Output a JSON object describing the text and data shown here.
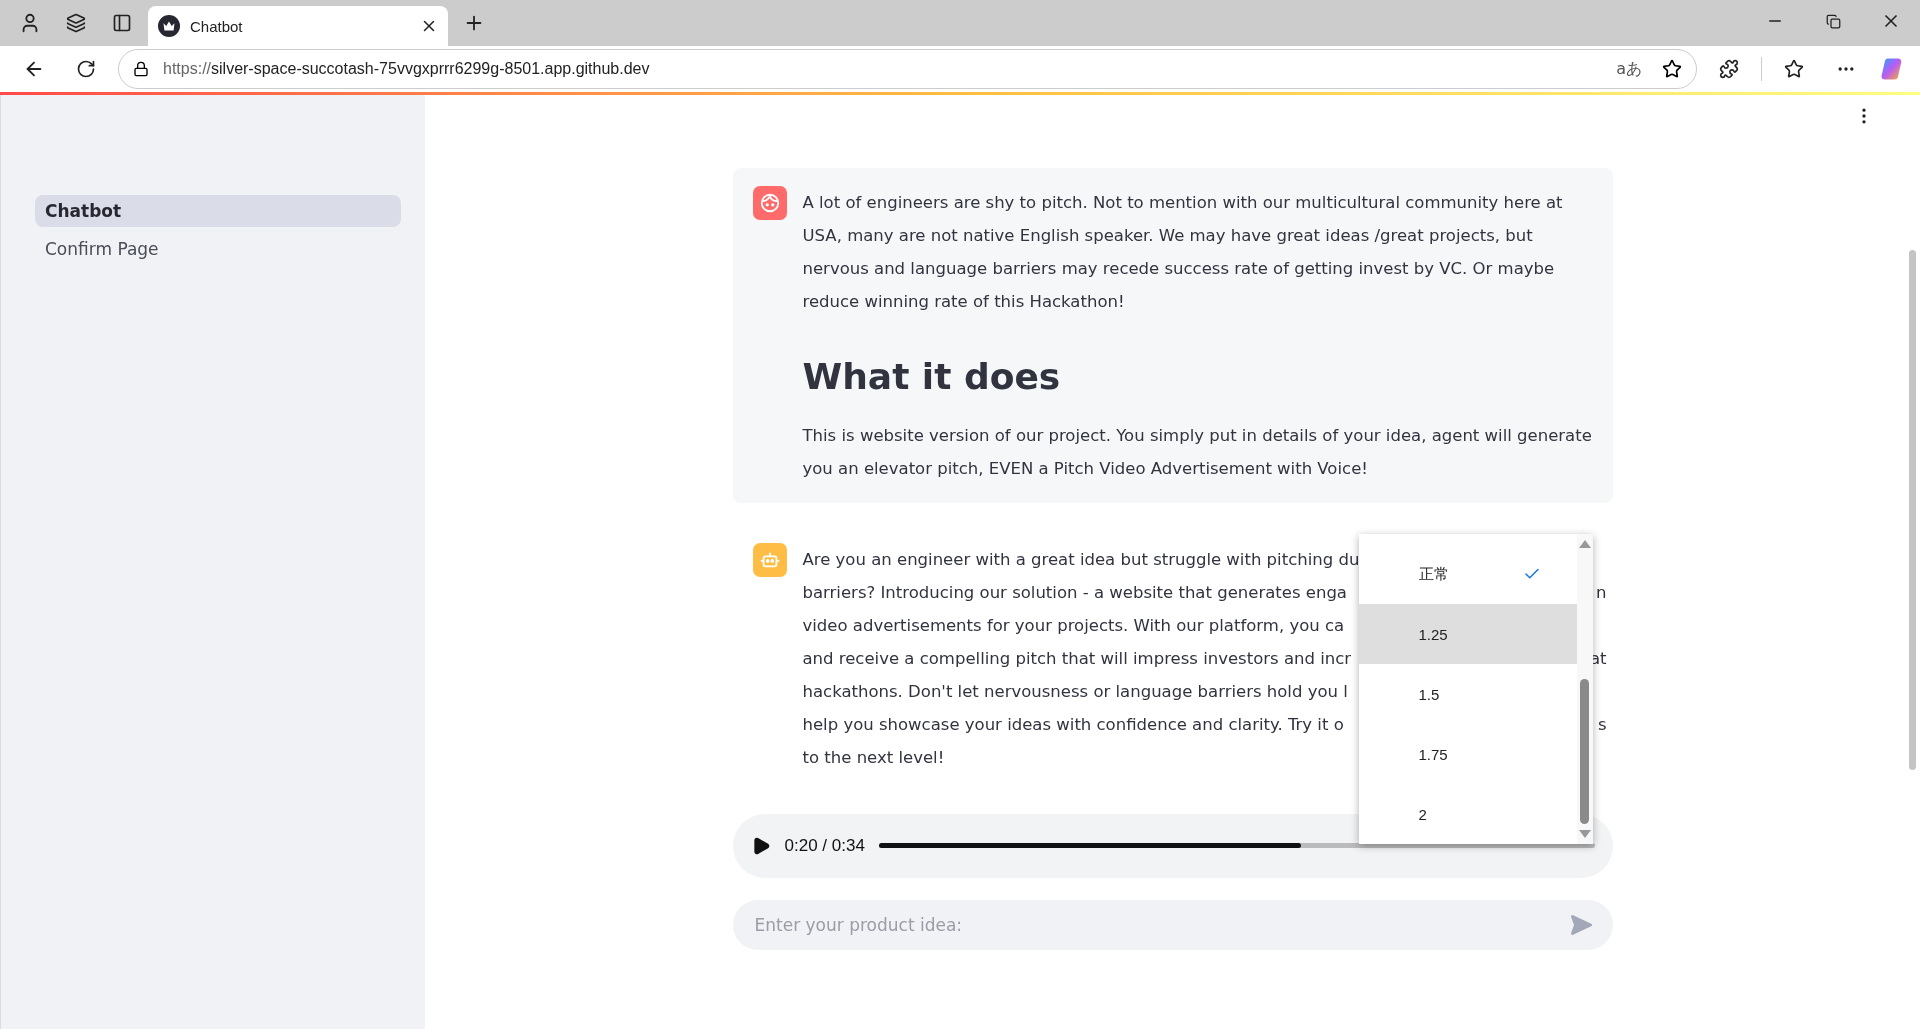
{
  "browser": {
    "tab": {
      "title": "Chatbot",
      "selected": true
    },
    "url": {
      "scheme": "https://",
      "host": "silver-space-succotash-75vvgxprrr6299g-8501.app.github.dev"
    },
    "read_aloud": "aあ"
  },
  "sidebar": {
    "items": [
      {
        "label": "Chatbot",
        "selected": true
      },
      {
        "label": "Confirm Page",
        "selected": false
      }
    ]
  },
  "messages": [
    {
      "kind": "user",
      "blocks": [
        {
          "kind": "paragraph",
          "text": "A lot of engineers are shy to pitch. Not to mention with our multicultural community here at USA, many are not native English speaker. We may have great ideas /great projects, but nervous and language barriers may recede success rate of getting invest by VC. Or maybe reduce winning rate of this Hackathon!"
        },
        {
          "kind": "heading",
          "text": "What it does"
        },
        {
          "kind": "paragraph",
          "text": "This is website version of our project. You simply put in details of your idea, agent will generate you an elevator pitch, EVEN a Pitch Video Advertisement with Voice!"
        }
      ]
    },
    {
      "kind": "assistant",
      "lines": [
        {
          "left": "Are you an engineer with a great idea but struggle with pitching du"
        },
        {
          "left": "barriers? Introducing our solution - a website that generates enga",
          "right": "n"
        },
        {
          "left": "video advertisements for your projects. With our platform, you ca"
        },
        {
          "left": "and receive a compelling pitch that will impress investors and incr",
          "right": "at"
        },
        {
          "left": "hackathons. Don't let nervousness or language barriers hold you l"
        },
        {
          "left": "help you showcase your ideas with confidence and clarity. Try it o",
          "right": "s"
        },
        {
          "left": "to the next level!"
        }
      ]
    }
  ],
  "audio": {
    "time": "0:20 / 0:34",
    "level": 0.59
  },
  "speed_menu": [
    {
      "label": "正常",
      "checked": true,
      "highlighted": false
    },
    {
      "label": "1.25",
      "checked": false,
      "highlighted": true
    },
    {
      "label": "1.5",
      "checked": false,
      "highlighted": false
    },
    {
      "label": "1.75",
      "checked": false,
      "highlighted": false
    },
    {
      "label": "2",
      "checked": false,
      "highlighted": false
    }
  ],
  "chat_input": {
    "placeholder": "Enter your product idea:"
  }
}
